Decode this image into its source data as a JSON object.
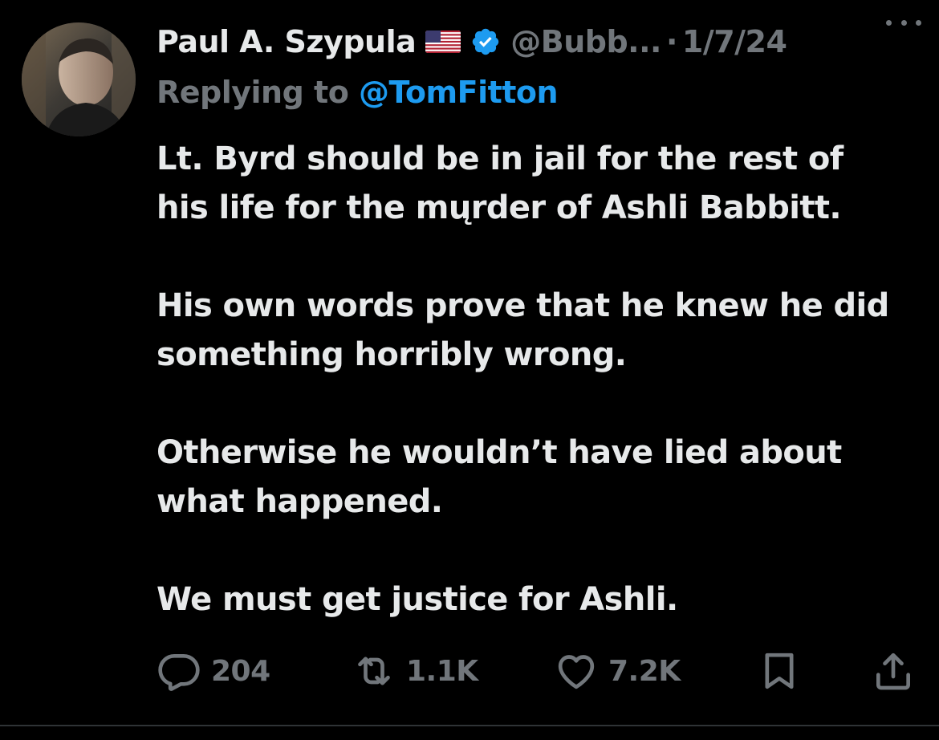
{
  "tweet": {
    "author": {
      "display_name": "Paul A. Szypula",
      "flag_emoji": "us-flag-icon",
      "verified_icon": "verified-badge-icon",
      "handle": "@Bubb...",
      "separator": "·",
      "date": "1/7/24"
    },
    "reply": {
      "prefix": "Replying to ",
      "mention": "@TomFitton"
    },
    "paragraphs": [
      "Lt. Byrd should be in jail for the rest of\nhis life for the mųrder of Ashli Babbitt.",
      "His own words prove that he knew he did\nsomething horribly wrong.",
      "Otherwise he wouldn’t have lied about\nwhat happened.",
      "We must get justice for Ashli."
    ],
    "actions": {
      "replies": "204",
      "retweets": "1.1K",
      "likes": "7.2K"
    }
  },
  "colors": {
    "background": "#000000",
    "text": "#e7e9ea",
    "secondary": "#71767b",
    "accent": "#1d9bf0"
  }
}
